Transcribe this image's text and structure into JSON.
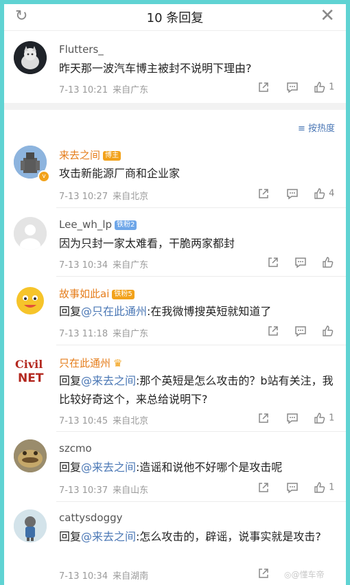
{
  "header": {
    "title": "10 条回复"
  },
  "original_post": {
    "username": "Flutters_",
    "text": "昨天那一波汽车博主被封不说明下理由?",
    "time": "7-13 10:21",
    "location": "来自广东",
    "likes": "1"
  },
  "sort": {
    "label": "按热度"
  },
  "replies": [
    {
      "username": "来去之间",
      "badge": "博主",
      "text": "攻击新能源厂商和企业家",
      "time": "7-13 10:27",
      "location": "来自北京",
      "likes": "4"
    },
    {
      "username": "Lee_wh_lp",
      "badge": "铁粉2",
      "text": "因为只封一家太难看，干脆两家都封",
      "time": "7-13 10:34",
      "location": "来自广东",
      "likes": ""
    },
    {
      "username": "故事如此ai",
      "badge": "铁粉5",
      "reply_prefix": "回复",
      "mention": "@只在此通州",
      "text": ":在我微博搜英短就知道了",
      "time": "7-13 11:18",
      "location": "来自广东",
      "likes": ""
    },
    {
      "username": "只在此通州",
      "badge": "",
      "reply_prefix": "回复",
      "mention": "@来去之间",
      "text": ":那个英短是怎么攻击的？b站有关注，我比较好奇这个，来总给说明下?",
      "time": "7-13 10:45",
      "location": "来自北京",
      "likes": "1"
    },
    {
      "username": "szcmo",
      "badge": "",
      "reply_prefix": "回复",
      "mention": "@来去之间",
      "text": ":造谣和说他不好哪个是攻击呢",
      "time": "7-13 10:37",
      "location": "来自山东",
      "likes": "1"
    },
    {
      "username": "cattysdoggy",
      "badge": "",
      "reply_prefix": "回复",
      "mention": "@来去之间",
      "text": ":怎么攻击的，辟谣，说事实就是攻击?",
      "time": "7-13 10:34",
      "location": "来自湖南",
      "likes": ""
    }
  ],
  "avatar_labels": {
    "civil": "Civil",
    "net": "NET"
  },
  "watermark": "@懂车帝",
  "colors": {
    "orange": "#e57d1b",
    "mention": "#4a77b5",
    "badge_blue": "#6ea6e8",
    "badge_orange": "#f2a21b"
  }
}
